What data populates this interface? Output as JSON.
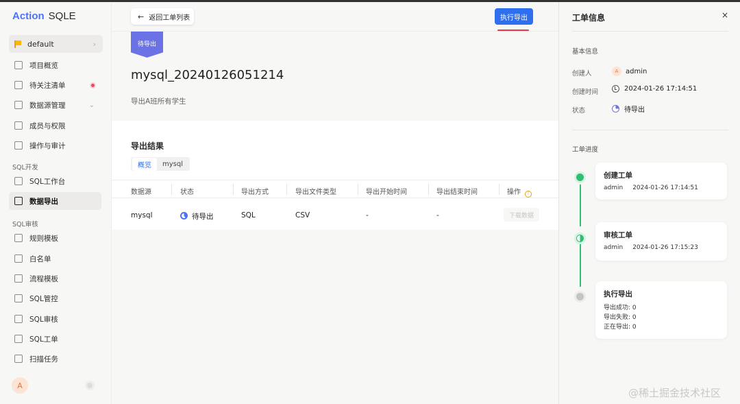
{
  "app": {
    "brand_a": "Action",
    "brand_b": "SQLE"
  },
  "sidebar": {
    "project": "default",
    "items": [
      {
        "label": "项目概览",
        "icon": "layers-icon"
      },
      {
        "label": "待关注清单",
        "icon": "dashboard-icon"
      },
      {
        "label": "数据源管理",
        "icon": "database-icon"
      },
      {
        "label": "成员与权限",
        "icon": "members-icon"
      },
      {
        "label": "操作与审计",
        "icon": "audit-icon"
      }
    ],
    "section_sql_dev": "SQL开发",
    "dev_items": [
      {
        "label": "SQL工作台",
        "icon": "monitor-icon"
      },
      {
        "label": "数据导出",
        "icon": "export-icon"
      }
    ],
    "section_sql_audit": "SQL审核",
    "audit_items": [
      {
        "label": "规则模板",
        "icon": "rule-icon"
      },
      {
        "label": "白名单",
        "icon": "whitelist-icon"
      },
      {
        "label": "流程模板",
        "icon": "flow-icon"
      },
      {
        "label": "SQL管控",
        "icon": "fingerprint-icon"
      },
      {
        "label": "SQL审核",
        "icon": "audit-doc-icon"
      },
      {
        "label": "SQL工单",
        "icon": "ticket-icon"
      },
      {
        "label": "扫描任务",
        "icon": "scan-icon"
      }
    ],
    "avatar": "A"
  },
  "main": {
    "back_label": "返回工单列表",
    "exec_label": "执行导出",
    "status_ribbon": "待导出",
    "title": "mysql_20240126051214",
    "description": "导出A班所有学生",
    "result_title": "导出结果",
    "tabs": [
      "概览",
      "mysql"
    ],
    "columns": [
      "数据源",
      "状态",
      "导出方式",
      "导出文件类型",
      "导出开始时间",
      "导出结束时间",
      "操作"
    ],
    "row": {
      "source": "mysql",
      "status": "待导出",
      "method": "SQL",
      "file_type": "CSV",
      "start": "-",
      "end": "-",
      "action": "下载数据"
    }
  },
  "panel": {
    "title": "工单信息",
    "close": "×",
    "basic_info": "基本信息",
    "creator_label": "创建人",
    "creator_avatar": "A",
    "creator": "admin",
    "created_label": "创建时间",
    "created_at": "2024-01-26 17:14:51",
    "status_label": "状态",
    "status": "待导出",
    "progress_title": "工单进度",
    "steps": [
      {
        "title": "创建工单",
        "user": "admin",
        "time": "2024-01-26 17:14:51"
      },
      {
        "title": "审核工单",
        "user": "admin",
        "time": "2024-01-26 17:15:23"
      },
      {
        "title": "执行导出",
        "lines": [
          "导出成功: 0",
          "导出失败: 0",
          "正在导出: 0"
        ]
      }
    ]
  },
  "watermark": "@稀土掘金技术社区",
  "colors": {
    "primary": "#2e6ff0",
    "pending": "#6b72e6",
    "success": "#2fbf71",
    "alert": "#e84a5f"
  }
}
